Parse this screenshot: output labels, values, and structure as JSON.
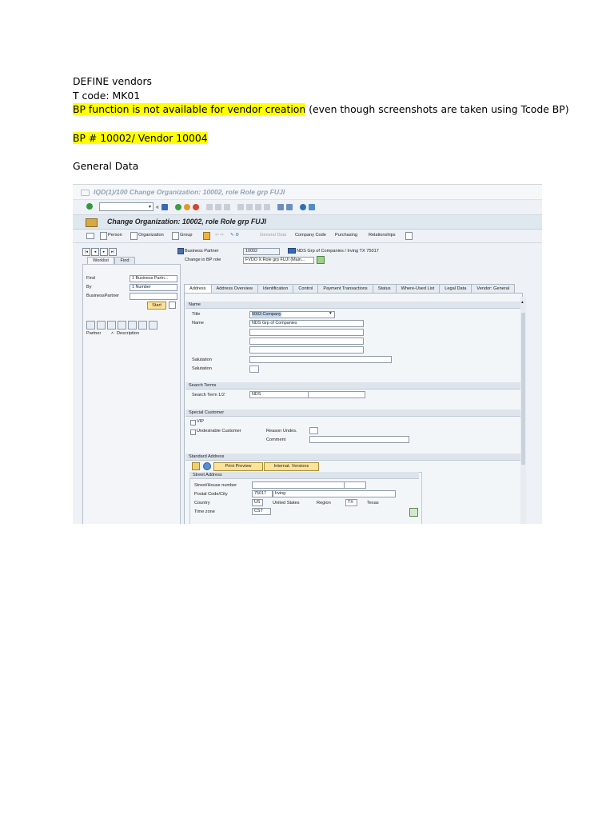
{
  "doc": {
    "line1": "DEFINE vendors",
    "line2": "T code: MK01",
    "line3_highlight": "BP function is not available for vendor creation",
    "line3_rest": " (even though screenshots are taken using Tcode BP)",
    "line4_highlight": "BP # 10002/ Vendor 10004",
    "line5": "General Data"
  },
  "sap": {
    "window_title": "IQD(1)/100 Change Organization: 10002, role Role grp FUJI",
    "app_title": "Change Organization: 10002, role Role grp FUJI",
    "toolbar": {
      "person": "Person",
      "organization": "Organization",
      "group": "Group",
      "general_data": "General Data",
      "company_code": "Company Code",
      "purchasing": "Purchasing",
      "relationships": "Relationships"
    },
    "header": {
      "business_partner_label": "Business Partner",
      "business_partner_value": "10002",
      "business_partner_desc": "NDS Grp of Companies / Irving TX 75017",
      "role_label": "Change in BP role",
      "role_value": "FVDO  X Role grp FUJI (Main..."
    },
    "left": {
      "tab_worklist": "Worklist",
      "tab_find": "Find",
      "find_label": "Find",
      "find_value": "1 Business Partn...",
      "by_label": "By",
      "by_value": "1 Number",
      "bp_label": "BusinessPartner",
      "start_button": "Start",
      "col_partner": "Partner",
      "col_description": "Description"
    },
    "tabs": [
      "Address",
      "Address Overview",
      "Identification",
      "Control",
      "Payment Transactions",
      "Status",
      "Where-Used List",
      "Legal Data",
      "Vendor: General"
    ],
    "name_section": {
      "header": "Name",
      "title_label": "Title",
      "title_value": "0003 Company",
      "name_label": "Name",
      "name_value": "NDS Grp of Companies",
      "salutation_label": "Salutation",
      "salutation2_label": "Salutation"
    },
    "search_section": {
      "header": "Search Terms",
      "label": "Search Term 1/2",
      "value": "NDS"
    },
    "special_section": {
      "header": "Special Customer",
      "vip": "VIP",
      "undesirable": "Undesirable Customer",
      "reason": "Reason Undes.",
      "comment": "Comment"
    },
    "address_section": {
      "header": "Standard Address",
      "print_preview": "Print Preview",
      "internat_versions": "Internat. Versions",
      "street_address": "Street Address",
      "street_label": "Street/House number",
      "postal_label": "Postal Code/City",
      "postal_value": "75017",
      "city_value": "Irving",
      "country_label": "Country",
      "country_code": "US",
      "country_name": "United States",
      "region_label": "Region",
      "region_code": "TX",
      "region_name": "Texas",
      "timezone_label": "Time zone",
      "timezone_value": "CST"
    }
  }
}
